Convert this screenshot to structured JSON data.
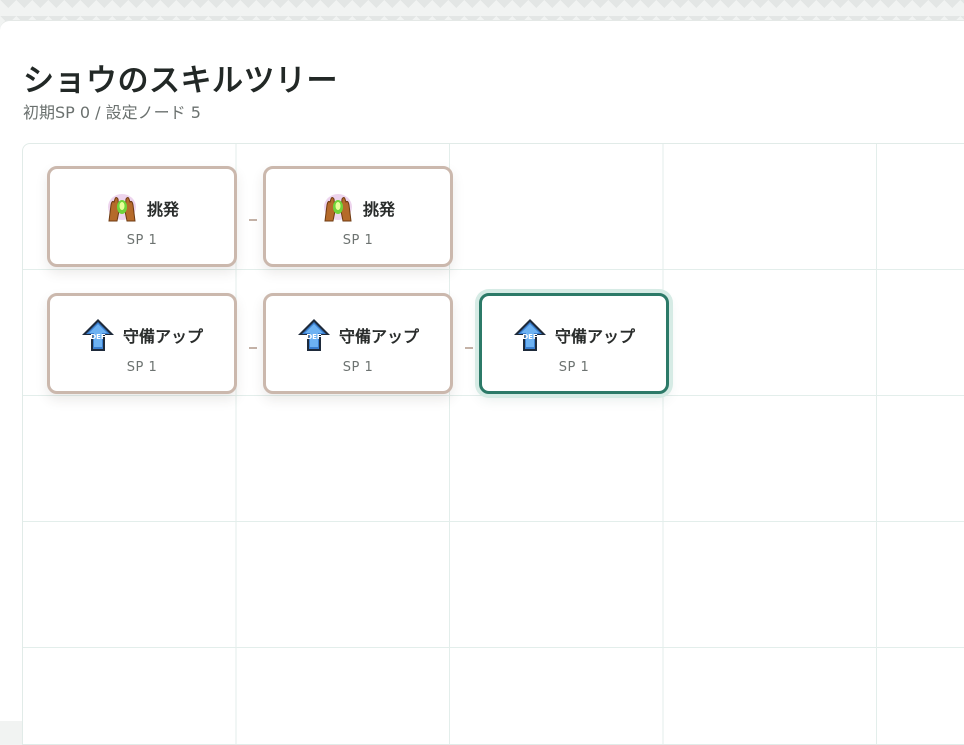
{
  "page": {
    "title": "ショウのスキルツリー",
    "subtitle": "初期SP 0 / 設定ノード 5"
  },
  "nodes": [
    {
      "name": "挑発",
      "sp": "SP 1",
      "icon": "taunt-hands-icon",
      "active": false
    },
    {
      "name": "挑発",
      "sp": "SP 1",
      "icon": "taunt-hands-icon",
      "active": false
    },
    {
      "name": "守備アップ",
      "sp": "SP 1",
      "icon": "defense-up-arrow-icon",
      "active": false
    },
    {
      "name": "守備アップ",
      "sp": "SP 1",
      "icon": "defense-up-arrow-icon",
      "active": false
    },
    {
      "name": "守備アップ",
      "sp": "SP 1",
      "icon": "defense-up-arrow-icon",
      "active": true
    }
  ],
  "colors": {
    "node_border": "#cbb8ad",
    "active_border": "#2c7a68",
    "grid_line": "#e3eeeb"
  }
}
